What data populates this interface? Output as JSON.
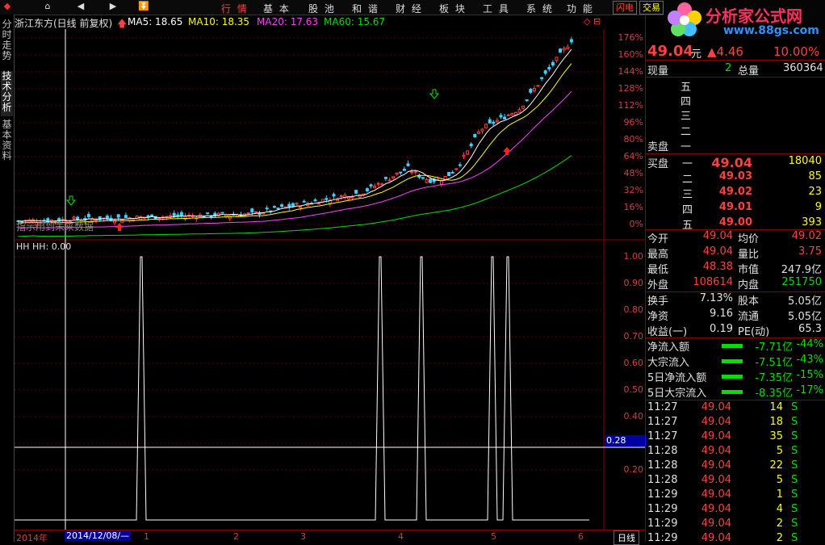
{
  "menu": [
    "行 情",
    "基 本",
    "股 池",
    "和 谐",
    "财 经",
    "板 块",
    "工 具",
    "系 统",
    "功 能"
  ],
  "tags": [
    "闪电",
    "交易"
  ],
  "logo": {
    "title": "分析家公式网",
    "url": "www.88gs.com"
  },
  "sidetabs": [
    "分时走势",
    "技术分析",
    "基本资料"
  ],
  "title": "浙江东方(日线 前复权)",
  "ma": [
    {
      "label": "MA5: 18.65",
      "color": "#ffffff"
    },
    {
      "label": "MA10: 18.35",
      "color": "#ffff00"
    },
    {
      "label": "MA20: 17.63",
      "color": "#ff40ff"
    },
    {
      "label": "MA60: 15.67",
      "color": "#00e000"
    }
  ],
  "overlay_text": "指示用到未来数据",
  "price_axis": [
    "176%",
    "160%",
    "144%",
    "128%",
    "112%",
    "96%",
    "80%",
    "64%",
    "48%",
    "32%",
    "16%",
    "0%"
  ],
  "indicator_title": "HH HH: 0.00",
  "indicator_axis": [
    "1.00",
    "0.90",
    "0.80",
    "0.70",
    "0.60",
    "0.50",
    "0.40",
    "0.30",
    "0.20"
  ],
  "indicator_current": "0.28",
  "dates": {
    "year": "2014年",
    "cursor": "2014/12/08/—",
    "months": [
      "1",
      "2",
      "3",
      "4",
      "5",
      "6"
    ],
    "period": "日线"
  },
  "quote": {
    "price": "49.04",
    "unit": "元",
    "change": "▲4.46",
    "pct": "10.00%"
  },
  "volume_row": {
    "label1": "现量",
    "v1": "2",
    "label2": "总量",
    "v2": "360364"
  },
  "sell": {
    "label": "卖盘",
    "levels": [
      "五",
      "四",
      "三",
      "二",
      "一"
    ]
  },
  "buy": {
    "label": "买盘",
    "levels": [
      {
        "n": "一",
        "p": "49.04",
        "v": "18040"
      },
      {
        "n": "二",
        "p": "49.03",
        "v": "85"
      },
      {
        "n": "三",
        "p": "49.02",
        "v": "23"
      },
      {
        "n": "四",
        "p": "49.01",
        "v": "9"
      },
      {
        "n": "五",
        "p": "49.00",
        "v": "393"
      }
    ]
  },
  "stats1": [
    {
      "l": "今开",
      "v": "49.04",
      "vc": "red",
      "l2": "均价",
      "v2": "49.02",
      "v2c": "red"
    },
    {
      "l": "最高",
      "v": "49.04",
      "vc": "red",
      "l2": "量比",
      "v2": "3.75",
      "v2c": "red"
    },
    {
      "l": "最低",
      "v": "48.38",
      "vc": "red",
      "l2": "市值",
      "v2": "247.9亿",
      "v2c": "white"
    },
    {
      "l": "外盘",
      "v": "108614",
      "vc": "red",
      "l2": "内盘",
      "v2": "251750",
      "v2c": "green"
    }
  ],
  "stats2": [
    {
      "l": "换手",
      "v": "7.13%",
      "l2": "股本",
      "v2": "5.05亿"
    },
    {
      "l": "净资",
      "v": "9.16",
      "l2": "流通",
      "v2": "5.05亿"
    },
    {
      "l": "收益(一)",
      "v": "0.19",
      "l2": "PE(动)",
      "v2": "65.3"
    }
  ],
  "flows": [
    {
      "l": "净流入额",
      "v": "-7.71亿",
      "p": "-44%"
    },
    {
      "l": "大宗流入",
      "v": "-7.51亿",
      "p": "-43%"
    },
    {
      "l": "5日净流入额",
      "v": "-7.35亿",
      "p": "-15%"
    },
    {
      "l": "5日大宗流入",
      "v": "-8.35亿",
      "p": "-17%"
    }
  ],
  "ticks": [
    {
      "t": "11:27",
      "p": "49.04",
      "v": "14",
      "s": "S"
    },
    {
      "t": "11:27",
      "p": "49.04",
      "v": "18",
      "s": "S"
    },
    {
      "t": "11:27",
      "p": "49.04",
      "v": "35",
      "s": "S"
    },
    {
      "t": "11:28",
      "p": "49.04",
      "v": "5",
      "s": "S"
    },
    {
      "t": "11:28",
      "p": "49.04",
      "v": "22",
      "s": "S"
    },
    {
      "t": "11:28",
      "p": "49.04",
      "v": "5",
      "s": "S"
    },
    {
      "t": "11:29",
      "p": "49.04",
      "v": "1",
      "s": "S"
    },
    {
      "t": "11:29",
      "p": "49.04",
      "v": "4",
      "s": "S"
    },
    {
      "t": "11:29",
      "p": "49.04",
      "v": "2",
      "s": "S"
    },
    {
      "t": "11:29",
      "p": "49.04",
      "v": "2",
      "s": "S"
    }
  ],
  "colors": {
    "up": "#ff4040",
    "down": "#00e000",
    "bg": "#000000",
    "grid": "#8b0000"
  }
}
